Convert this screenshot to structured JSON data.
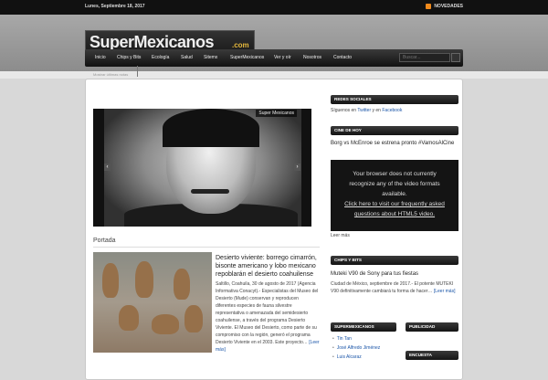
{
  "topbar": {
    "date": "Lunes, Septiembre 18, 2017",
    "news_label": "NOVEDADES"
  },
  "logo": {
    "text": "SuperMexicanos",
    "suffix": ".com",
    "stars": "★★★★★"
  },
  "nav": {
    "items": [
      "Inicio",
      "Chips y Bits",
      "Ecología",
      "Salud",
      "Sitemx",
      "SuperMexicanos",
      "Ver y oír",
      "Nosotros",
      "Contacto"
    ],
    "search_placeholder": "Buscar..."
  },
  "breadcrumb": "Mostrar últimas notas",
  "slider": {
    "caption": "Super Mexicanos",
    "prev": "‹",
    "next": "›"
  },
  "main": {
    "section_title": "Portada",
    "article": {
      "title": "Desierto viviente: borrego cimarrón, bisonte americano y lobo mexicano repoblarán el desierto coahuilense",
      "excerpt": "Saltillo, Coahuila, 30 de agosto de 2017 (Agencia Informativa Conacyt).- Especialistas del Museo del Desierto (Mude) conservan y reproducen diferentes especies de fauna silvestre representativa o amenazada del semidesierto coahuilense, a través del programa Desierto Viviente. El Museo del Desierto, como parte de su compromiso con la región, generó el programa Desierto Viviente en el 2003. Este proyecto…",
      "more": "[Leer más]"
    }
  },
  "sidebar": {
    "social": {
      "title": "REDES SOCIALES",
      "text_before": "Síguenos en ",
      "twitter": "Twitter",
      "text_mid": " y en ",
      "facebook": "Facebook"
    },
    "cine": {
      "title": "CINE DE HOY",
      "headline": "Borg vs McEnroe se estrena pronto #VamosAlCine",
      "video_line1": "Your browser does not currently",
      "video_line2": "recognize any of the video formats",
      "video_line3": "available.",
      "video_link1": "Click here to visit our frequently asked",
      "video_link2": "questions about HTML5 video.",
      "more": "Leer más"
    },
    "chips": {
      "title": "CHIPS Y BITS",
      "headline": "Muteki V90 de Sony para tus fiestas",
      "excerpt": "Ciudad de México, septiembre de 2017.- El potente MUTEKI V90 definitivamente cambiará tu forma de hacer…",
      "more": "[Leer más]"
    },
    "supermexicanos": {
      "title": "SUPERMEXICANOS",
      "items": [
        "Tin Tan",
        "José Alfredo Jiménez",
        "Luis Alcaraz"
      ]
    },
    "publicidad": {
      "title": "PUBLICIDAD"
    },
    "encuesta": {
      "title": "ENCUESTA"
    }
  },
  "colors": {
    "accent": "#1a55a8",
    "rss": "#f08a1c",
    "gold": "#e6b93d"
  }
}
